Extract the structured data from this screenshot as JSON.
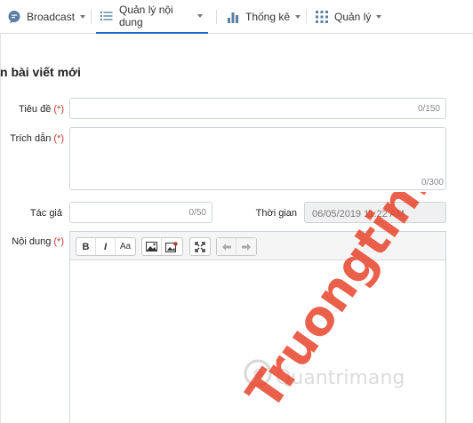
{
  "nav": {
    "items": [
      {
        "label": "Broadcast",
        "icon": "chat-bubble-icon"
      },
      {
        "label": "Quản lý nội dung",
        "icon": "list-icon"
      },
      {
        "label": "Thống kê",
        "icon": "bar-chart-icon"
      },
      {
        "label": "Quản lý",
        "icon": "grid-icon"
      }
    ],
    "active_index": 1,
    "accent_color": "#1a6ec8"
  },
  "form": {
    "title": "n bài viết mới",
    "fields": {
      "title": {
        "label": "Tiêu đề",
        "required_mark": "(*)",
        "counter": "0/150"
      },
      "excerpt": {
        "label": "Trích dẫn",
        "required_mark": "(*)",
        "counter": "0/300"
      },
      "author": {
        "label": "Tác giả",
        "counter": "0/50"
      },
      "time": {
        "label": "Thời gian",
        "value": "06/05/2019 11:22 AM"
      },
      "content": {
        "label": "Nội dung",
        "required_mark": "(*)"
      }
    },
    "editor_toolbar": {
      "bold": "B",
      "italic": "I",
      "font_size": "Aa",
      "icons": [
        "image-icon",
        "video-icon",
        "fullscreen-icon",
        "undo-icon",
        "redo-icon"
      ]
    },
    "required_color": "#c0392b"
  },
  "watermark": {
    "text": "Truongtin.top",
    "color": "#e8442a",
    "secondary_text": "Quantrimang"
  }
}
